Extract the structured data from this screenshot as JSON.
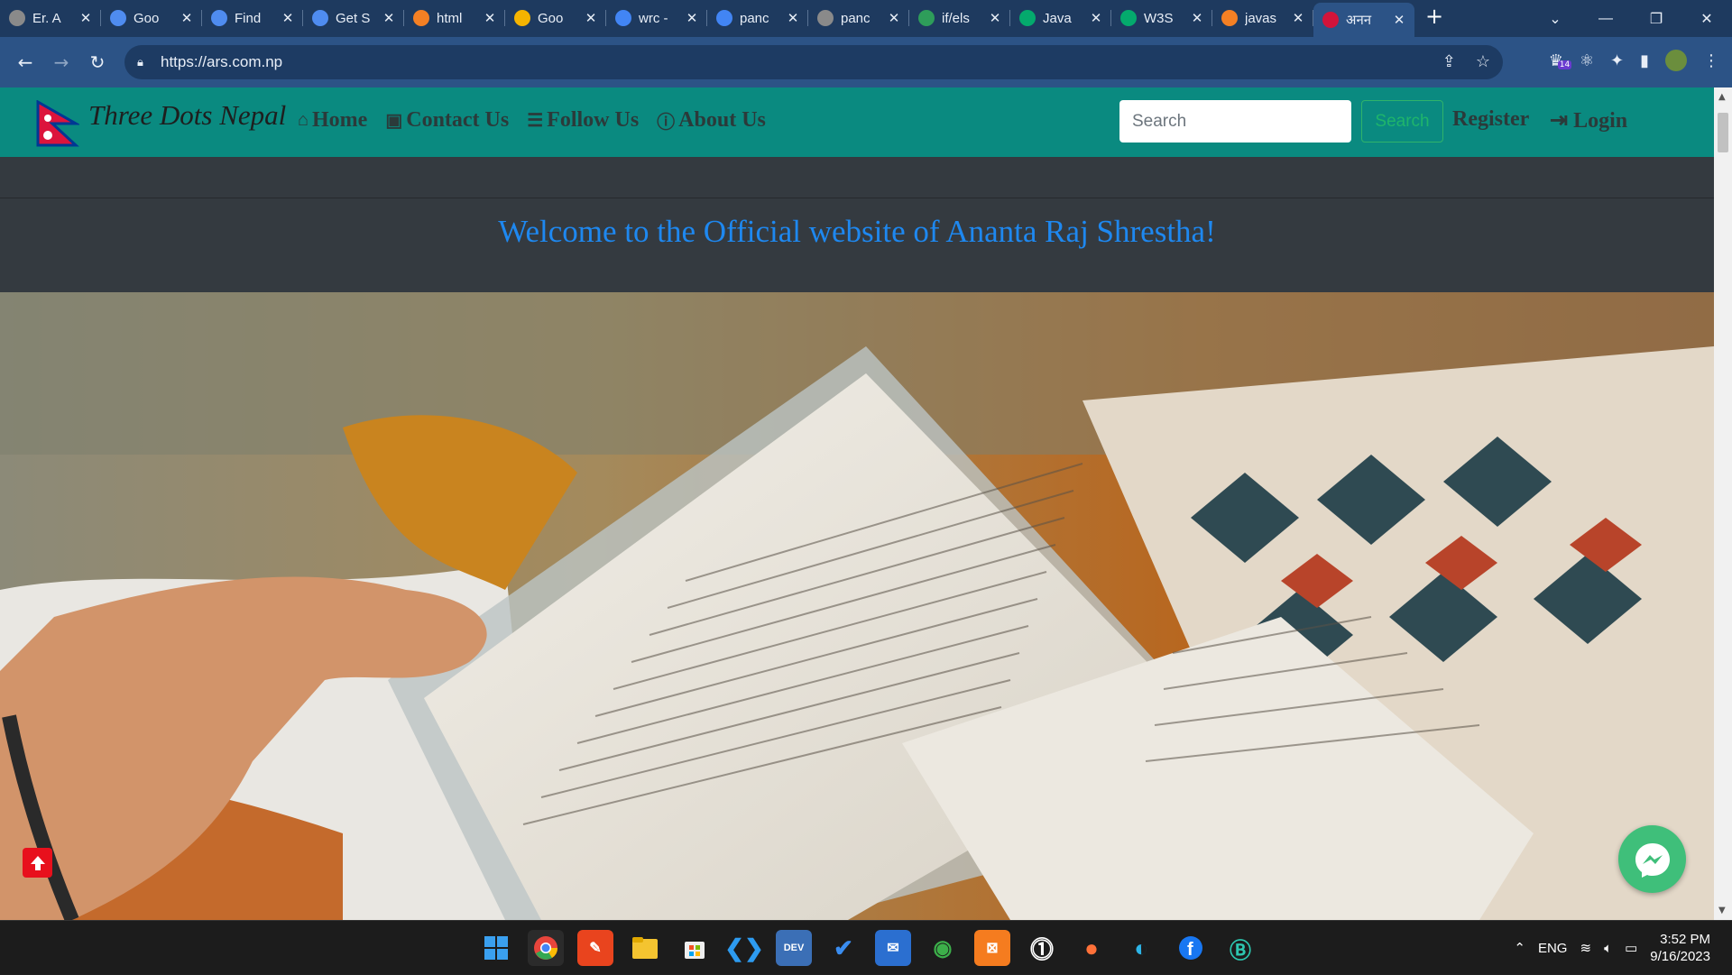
{
  "browser": {
    "tabs": [
      {
        "title": "Er. A",
        "favicon_color": "#8a8a8a"
      },
      {
        "title": "Goo",
        "favicon_color": "#4f8cf0"
      },
      {
        "title": "Find",
        "favicon_color": "#4f8cf0"
      },
      {
        "title": "Get S",
        "favicon_color": "#4f8cf0"
      },
      {
        "title": "html",
        "favicon_color": "#f48024"
      },
      {
        "title": "Goo",
        "favicon_color": "#f5b400"
      },
      {
        "title": "wrc -",
        "favicon_color": "#4285f4"
      },
      {
        "title": "panc",
        "favicon_color": "#4285f4"
      },
      {
        "title": "panc",
        "favicon_color": "#8a8a8a"
      },
      {
        "title": "if/els",
        "favicon_color": "#2e9d5a"
      },
      {
        "title": "Java",
        "favicon_color": "#04aa6d"
      },
      {
        "title": "W3S",
        "favicon_color": "#04aa6d"
      },
      {
        "title": "javas",
        "favicon_color": "#f48024"
      },
      {
        "title": "अनन",
        "favicon_color": "#d2143a",
        "active": true
      }
    ],
    "url": "https://ars.com.np",
    "extension_badge": "14"
  },
  "site": {
    "brand": "Three Dots Nepal",
    "nav": [
      {
        "label": "Home",
        "icon": "home-icon"
      },
      {
        "label": "Contact Us",
        "icon": "contact-card-icon"
      },
      {
        "label": "Follow Us",
        "icon": "list-icon"
      },
      {
        "label": "About Us",
        "icon": "info-icon"
      }
    ],
    "search_placeholder": "Search",
    "search_button": "Search",
    "register": "Register",
    "login": "Login",
    "welcome": "Welcome to the Official website of Ananta Raj Shrestha!"
  },
  "colors": {
    "navbar": "#0a8a80",
    "welcome_text": "#1e88f0",
    "page_bg": "#343a40",
    "backtop": "#e8101c",
    "messenger": "#3fbf7a"
  },
  "taskbar": {
    "language": "ENG",
    "time": "3:52 PM",
    "date": "9/16/2023"
  }
}
